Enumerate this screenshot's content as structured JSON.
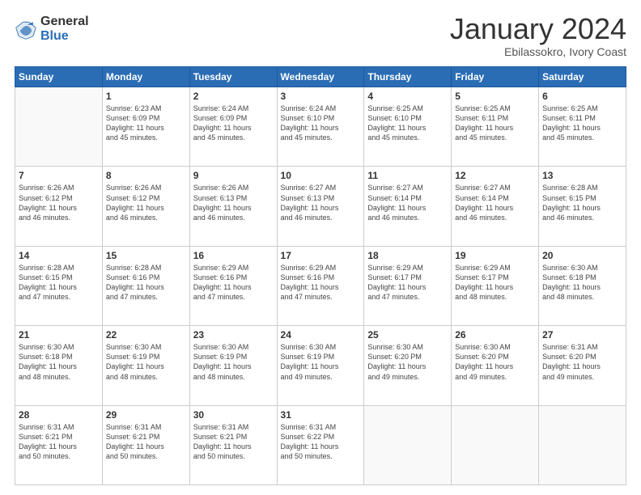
{
  "header": {
    "logo_general": "General",
    "logo_blue": "Blue",
    "month_title": "January 2024",
    "subtitle": "Ebilassokro, Ivory Coast"
  },
  "weekdays": [
    "Sunday",
    "Monday",
    "Tuesday",
    "Wednesday",
    "Thursday",
    "Friday",
    "Saturday"
  ],
  "weeks": [
    [
      {
        "day": "",
        "info": ""
      },
      {
        "day": "1",
        "info": "Sunrise: 6:23 AM\nSunset: 6:09 PM\nDaylight: 11 hours\nand 45 minutes."
      },
      {
        "day": "2",
        "info": "Sunrise: 6:24 AM\nSunset: 6:09 PM\nDaylight: 11 hours\nand 45 minutes."
      },
      {
        "day": "3",
        "info": "Sunrise: 6:24 AM\nSunset: 6:10 PM\nDaylight: 11 hours\nand 45 minutes."
      },
      {
        "day": "4",
        "info": "Sunrise: 6:25 AM\nSunset: 6:10 PM\nDaylight: 11 hours\nand 45 minutes."
      },
      {
        "day": "5",
        "info": "Sunrise: 6:25 AM\nSunset: 6:11 PM\nDaylight: 11 hours\nand 45 minutes."
      },
      {
        "day": "6",
        "info": "Sunrise: 6:25 AM\nSunset: 6:11 PM\nDaylight: 11 hours\nand 45 minutes."
      }
    ],
    [
      {
        "day": "7",
        "info": "Sunrise: 6:26 AM\nSunset: 6:12 PM\nDaylight: 11 hours\nand 46 minutes."
      },
      {
        "day": "8",
        "info": "Sunrise: 6:26 AM\nSunset: 6:12 PM\nDaylight: 11 hours\nand 46 minutes."
      },
      {
        "day": "9",
        "info": "Sunrise: 6:26 AM\nSunset: 6:13 PM\nDaylight: 11 hours\nand 46 minutes."
      },
      {
        "day": "10",
        "info": "Sunrise: 6:27 AM\nSunset: 6:13 PM\nDaylight: 11 hours\nand 46 minutes."
      },
      {
        "day": "11",
        "info": "Sunrise: 6:27 AM\nSunset: 6:14 PM\nDaylight: 11 hours\nand 46 minutes."
      },
      {
        "day": "12",
        "info": "Sunrise: 6:27 AM\nSunset: 6:14 PM\nDaylight: 11 hours\nand 46 minutes."
      },
      {
        "day": "13",
        "info": "Sunrise: 6:28 AM\nSunset: 6:15 PM\nDaylight: 11 hours\nand 46 minutes."
      }
    ],
    [
      {
        "day": "14",
        "info": "Sunrise: 6:28 AM\nSunset: 6:15 PM\nDaylight: 11 hours\nand 47 minutes."
      },
      {
        "day": "15",
        "info": "Sunrise: 6:28 AM\nSunset: 6:16 PM\nDaylight: 11 hours\nand 47 minutes."
      },
      {
        "day": "16",
        "info": "Sunrise: 6:29 AM\nSunset: 6:16 PM\nDaylight: 11 hours\nand 47 minutes."
      },
      {
        "day": "17",
        "info": "Sunrise: 6:29 AM\nSunset: 6:16 PM\nDaylight: 11 hours\nand 47 minutes."
      },
      {
        "day": "18",
        "info": "Sunrise: 6:29 AM\nSunset: 6:17 PM\nDaylight: 11 hours\nand 47 minutes."
      },
      {
        "day": "19",
        "info": "Sunrise: 6:29 AM\nSunset: 6:17 PM\nDaylight: 11 hours\nand 48 minutes."
      },
      {
        "day": "20",
        "info": "Sunrise: 6:30 AM\nSunset: 6:18 PM\nDaylight: 11 hours\nand 48 minutes."
      }
    ],
    [
      {
        "day": "21",
        "info": "Sunrise: 6:30 AM\nSunset: 6:18 PM\nDaylight: 11 hours\nand 48 minutes."
      },
      {
        "day": "22",
        "info": "Sunrise: 6:30 AM\nSunset: 6:19 PM\nDaylight: 11 hours\nand 48 minutes."
      },
      {
        "day": "23",
        "info": "Sunrise: 6:30 AM\nSunset: 6:19 PM\nDaylight: 11 hours\nand 48 minutes."
      },
      {
        "day": "24",
        "info": "Sunrise: 6:30 AM\nSunset: 6:19 PM\nDaylight: 11 hours\nand 49 minutes."
      },
      {
        "day": "25",
        "info": "Sunrise: 6:30 AM\nSunset: 6:20 PM\nDaylight: 11 hours\nand 49 minutes."
      },
      {
        "day": "26",
        "info": "Sunrise: 6:30 AM\nSunset: 6:20 PM\nDaylight: 11 hours\nand 49 minutes."
      },
      {
        "day": "27",
        "info": "Sunrise: 6:31 AM\nSunset: 6:20 PM\nDaylight: 11 hours\nand 49 minutes."
      }
    ],
    [
      {
        "day": "28",
        "info": "Sunrise: 6:31 AM\nSunset: 6:21 PM\nDaylight: 11 hours\nand 50 minutes."
      },
      {
        "day": "29",
        "info": "Sunrise: 6:31 AM\nSunset: 6:21 PM\nDaylight: 11 hours\nand 50 minutes."
      },
      {
        "day": "30",
        "info": "Sunrise: 6:31 AM\nSunset: 6:21 PM\nDaylight: 11 hours\nand 50 minutes."
      },
      {
        "day": "31",
        "info": "Sunrise: 6:31 AM\nSunset: 6:22 PM\nDaylight: 11 hours\nand 50 minutes."
      },
      {
        "day": "",
        "info": ""
      },
      {
        "day": "",
        "info": ""
      },
      {
        "day": "",
        "info": ""
      }
    ]
  ]
}
